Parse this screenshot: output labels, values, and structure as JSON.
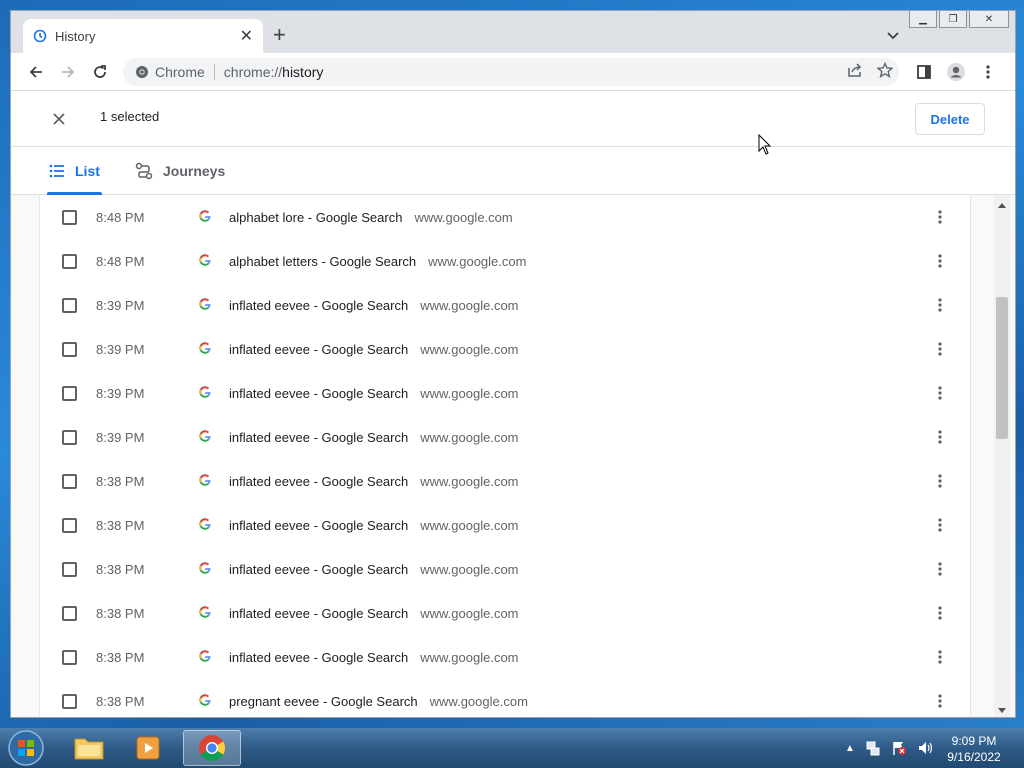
{
  "browser": {
    "tab_title": "History",
    "omnibox_site": "Chrome",
    "omnibox_url_scheme": "chrome://",
    "omnibox_url_host": "history"
  },
  "selection": {
    "count_text": "1 selected",
    "delete_label": "Delete"
  },
  "page_tabs": [
    {
      "label": "List",
      "icon": "list-icon",
      "active": true
    },
    {
      "label": "Journeys",
      "icon": "journeys-icon",
      "active": false
    }
  ],
  "history": [
    {
      "time": "8:48 PM",
      "title": "alphabet lore - Google Search",
      "domain": "www.google.com"
    },
    {
      "time": "8:48 PM",
      "title": "alphabet letters - Google Search",
      "domain": "www.google.com"
    },
    {
      "time": "8:39 PM",
      "title": "inflated eevee - Google Search",
      "domain": "www.google.com"
    },
    {
      "time": "8:39 PM",
      "title": "inflated eevee - Google Search",
      "domain": "www.google.com"
    },
    {
      "time": "8:39 PM",
      "title": "inflated eevee - Google Search",
      "domain": "www.google.com"
    },
    {
      "time": "8:39 PM",
      "title": "inflated eevee - Google Search",
      "domain": "www.google.com"
    },
    {
      "time": "8:38 PM",
      "title": "inflated eevee - Google Search",
      "domain": "www.google.com"
    },
    {
      "time": "8:38 PM",
      "title": "inflated eevee - Google Search",
      "domain": "www.google.com"
    },
    {
      "time": "8:38 PM",
      "title": "inflated eevee - Google Search",
      "domain": "www.google.com"
    },
    {
      "time": "8:38 PM",
      "title": "inflated eevee - Google Search",
      "domain": "www.google.com"
    },
    {
      "time": "8:38 PM",
      "title": "inflated eevee - Google Search",
      "domain": "www.google.com"
    },
    {
      "time": "8:38 PM",
      "title": "pregnant eevee - Google Search",
      "domain": "www.google.com"
    }
  ],
  "taskbar": {
    "clock_time": "9:09 PM",
    "clock_date": "9/16/2022",
    "apps": [
      "windows-explorer",
      "media-player",
      "chrome"
    ]
  },
  "colors": {
    "accent": "#1a73e8",
    "page_bg": "#f8f9fa",
    "tab_strip": "#dee1e6"
  }
}
